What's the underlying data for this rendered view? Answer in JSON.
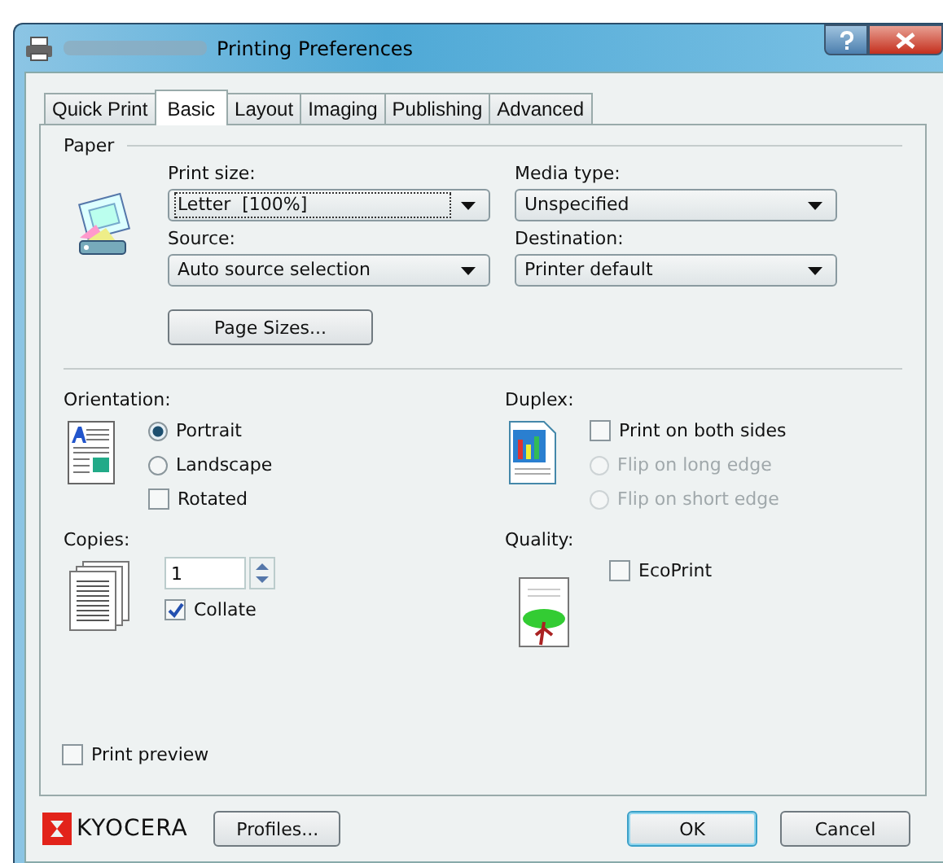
{
  "window": {
    "title": "Printing Preferences"
  },
  "tabs": [
    {
      "label": "Quick Print",
      "selected": false
    },
    {
      "label": "Basic",
      "selected": true
    },
    {
      "label": "Layout",
      "selected": false
    },
    {
      "label": "Imaging",
      "selected": false
    },
    {
      "label": "Publishing",
      "selected": false
    },
    {
      "label": "Advanced",
      "selected": false
    }
  ],
  "paper": {
    "title": "Paper",
    "fields": [
      {
        "label": "Print size:",
        "value": "Letter  [100%]",
        "focused": true
      },
      {
        "label": "Media type:",
        "value": "Unspecified",
        "focused": false
      },
      {
        "label": "Source:",
        "value": "Auto source selection",
        "focused": false
      },
      {
        "label": "Destination:",
        "value": "Printer default",
        "focused": false
      }
    ],
    "page_sizes_button": "Page Sizes..."
  },
  "orientation": {
    "title": "Orientation:",
    "options": [
      {
        "kind": "radio",
        "label": "Portrait",
        "selected": true,
        "disabled": false
      },
      {
        "kind": "radio",
        "label": "Landscape",
        "selected": false,
        "disabled": false
      },
      {
        "kind": "checkbox",
        "label": "Rotated",
        "checked": false,
        "disabled": false
      }
    ]
  },
  "duplex": {
    "title": "Duplex:",
    "options": [
      {
        "kind": "checkbox",
        "label": "Print on both sides",
        "checked": false,
        "disabled": false
      },
      {
        "kind": "radio",
        "label": "Flip on long edge",
        "selected": false,
        "disabled": true
      },
      {
        "kind": "radio",
        "label": "Flip on short edge",
        "selected": false,
        "disabled": true
      }
    ]
  },
  "copies": {
    "title": "Copies:",
    "value": "1",
    "collate": {
      "label": "Collate",
      "checked": true
    }
  },
  "quality": {
    "title": "Quality:",
    "ecoprint": {
      "label": "EcoPrint",
      "checked": false
    }
  },
  "print_preview": {
    "label": "Print preview",
    "checked": false
  },
  "footer": {
    "logo": "KYOCERA",
    "buttons": [
      {
        "label": "Profiles...",
        "kind": "left",
        "default": false
      },
      {
        "label": "OK",
        "kind": "right",
        "default": true
      },
      {
        "label": "Cancel",
        "kind": "right",
        "default": false
      }
    ]
  }
}
